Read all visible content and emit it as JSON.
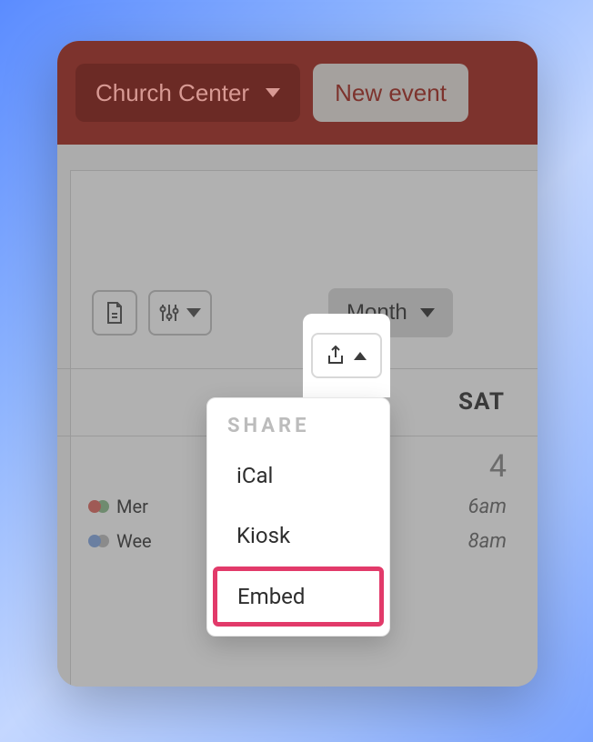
{
  "header": {
    "dropdown_label": "Church Center",
    "new_event_label": "New event"
  },
  "toolbar": {
    "view_label": "Month"
  },
  "calendar": {
    "day_header": "SAT",
    "day_number": "4",
    "events": [
      {
        "label_preview": "Mer",
        "time": "6am"
      },
      {
        "label_preview": "Wee",
        "time": "8am"
      }
    ]
  },
  "share_menu": {
    "title": "SHARE",
    "items": [
      "iCal",
      "Kiosk",
      "Embed"
    ],
    "highlighted": "Embed"
  }
}
